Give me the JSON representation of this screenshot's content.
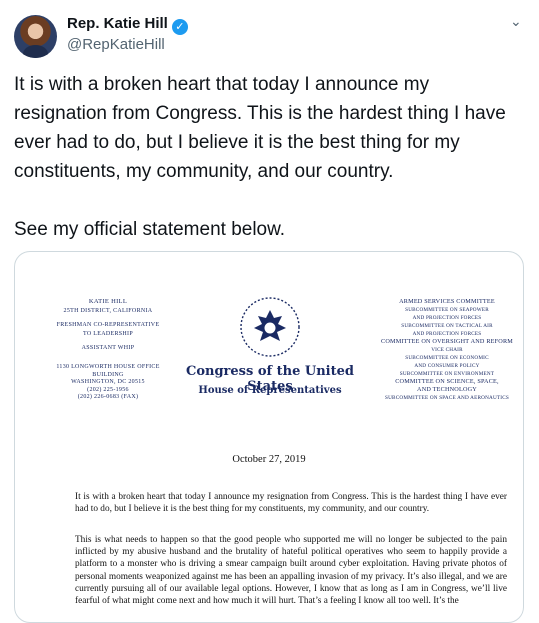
{
  "user": {
    "name": "Rep. Katie Hill",
    "handle": "@RepKatieHill"
  },
  "tweet": {
    "text": "It is with a broken heart that today I announce my resignation from Congress. This is the hardest thing I have ever had to do, but I believe it is the best thing for my constituents, my community, and our country.\n\nSee my official statement below."
  },
  "letter": {
    "left_head": {
      "name": "KATIE HILL",
      "district": "25TH DISTRICT, CALIFORNIA",
      "role1": "FRESHMAN CO-REPRESENTATIVE",
      "role2": "TO LEADERSHIP",
      "role3": "ASSISTANT WHIP",
      "addr1": "1130 LONGWORTH HOUSE OFFICE BUILDING",
      "addr2": "WASHINGTON, DC 20515",
      "phone": "(202) 225-1956",
      "fax": "(202) 226-0683 (FAX)"
    },
    "right_head": {
      "c1": "ARMED SERVICES COMMITTEE",
      "c1a": "SUBCOMMITTEE ON SEAPOWER",
      "c1b": "AND PROJECTION FORCES",
      "c1c": "SUBCOMMITTEE ON TACTICAL AIR",
      "c1d": "AND PROJECTION FORCES",
      "c2": "COMMITTEE ON OVERSIGHT AND REFORM",
      "c2a": "VICE CHAIR",
      "c2b": "SUBCOMMITTEE ON ECONOMIC",
      "c2c": "AND CONSUMER POLICY",
      "c2d": "SUBCOMMITTEE ON ENVIRONMENT",
      "c3": "COMMITTEE ON SCIENCE, SPACE,",
      "c3a": "AND TECHNOLOGY",
      "c3b": "SUBCOMMITTEE ON SPACE AND AERONAUTICS"
    },
    "congress_title": "Congress of the United States",
    "house_title": "House of Representatives",
    "date": "October 27, 2019",
    "p1": "It is with a broken heart that today I announce my resignation from Congress. This is the hardest thing I have ever had to do, but I believe it is the best thing for my constituents, my community, and our country.",
    "p2": "This is what needs to happen so that the good people who supported me will no longer be subjected to the pain inflicted by my abusive husband and the brutality of hateful political operatives who seem to happily provide a platform to a monster who is driving a smear campaign built around cyber exploitation. Having private photos of personal moments weaponized against me has been an appalling invasion of my privacy. It’s also illegal, and we are currently pursuing all of our available legal options. However, I know that as long as I am in Congress, we’ll live fearful of what might come next and how much it will hurt. That’s a feeling I know all too well. It’s the"
  }
}
